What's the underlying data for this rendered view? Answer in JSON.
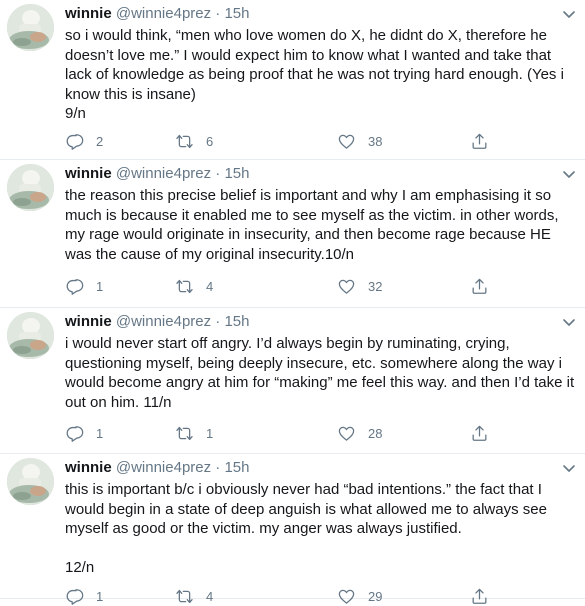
{
  "tweets": [
    {
      "name": "winnie",
      "handle": "@winnie4prez",
      "dot": "·",
      "time": "15h",
      "text": "so i would think, “men who love women do X, he didnt do X, therefore he doesn’t love me.” I would expect him to know what I wanted and take that lack of knowledge as being proof that he was not trying hard enough. (Yes i know this is insane)\n9/n",
      "replies": "2",
      "retweets": "6",
      "likes": "38"
    },
    {
      "name": "winnie",
      "handle": "@winnie4prez",
      "dot": "·",
      "time": "15h",
      "text": "the reason this precise belief is important and why I am emphasising it so much is because it enabled me to see myself as the victim. in other words, my rage would originate in insecurity, and then become rage because HE was the cause of my original insecurity.10/n",
      "replies": "1",
      "retweets": "4",
      "likes": "32"
    },
    {
      "name": "winnie",
      "handle": "@winnie4prez",
      "dot": "·",
      "time": "15h",
      "text": "i would never start off angry. I’d always begin by ruminating, crying, questioning myself, being deeply insecure, etc. somewhere along the way i would become angry at him for “making” me feel this way. and then I’d take it out on him. 11/n",
      "replies": "1",
      "retweets": "1",
      "likes": "28"
    },
    {
      "name": "winnie",
      "handle": "@winnie4prez",
      "dot": "·",
      "time": "15h",
      "text": "this is important b/c i obviously never had “bad intentions.” the fact that I would begin in a state of deep anguish is what allowed me to always see myself as good or the victim. my anger was always justified.\n\n12/n",
      "replies": "1",
      "retweets": "4",
      "likes": "29"
    }
  ],
  "icons": {
    "reply": "reply-icon",
    "retweet": "retweet-icon",
    "like": "heart-icon",
    "share": "share-icon",
    "caret": "chevron-down-icon"
  },
  "colors": {
    "text": "#14171a",
    "muted": "#657786",
    "divider": "#e6ecf0"
  }
}
